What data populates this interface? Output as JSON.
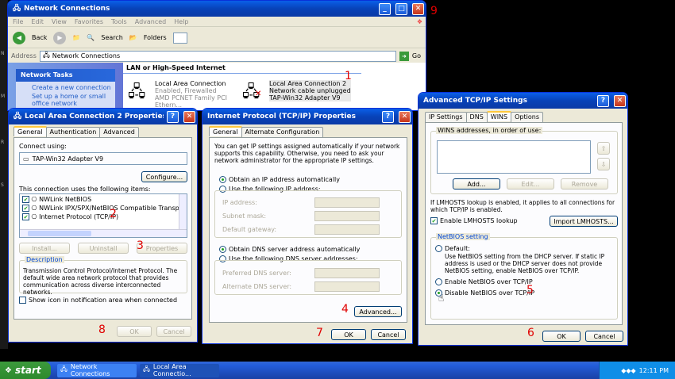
{
  "nc": {
    "title": "Network Connections",
    "menu": [
      "File",
      "Edit",
      "View",
      "Favorites",
      "Tools",
      "Advanced",
      "Help"
    ],
    "back": "Back",
    "search": "Search",
    "folders": "Folders",
    "address_label": "Address",
    "address": "Network Connections",
    "go": "Go",
    "section": "LAN or High-Speed Internet",
    "tasks_title": "Network Tasks",
    "task1": "Create a new connection",
    "task2": "Set up a home or small",
    "task3": "office network",
    "lac1": {
      "name": "Local Area Connection",
      "status": "Enabled, Firewalled",
      "device": "AMD PCNET Family PCI Ethern..."
    },
    "lac2": {
      "name": "Local Area Connection 2",
      "status": "Network cable unplugged",
      "device": "TAP-Win32 Adapter V9"
    }
  },
  "lp": {
    "title": "Local Area Connection 2 Properties",
    "tabs": [
      "General",
      "Authentication",
      "Advanced"
    ],
    "connect_using": "Connect using:",
    "adapter": "TAP-Win32 Adapter V9",
    "configure": "Configure...",
    "items_label": "This connection uses the following items:",
    "items": [
      "NWLink NetBIOS",
      "NWLink IPX/SPX/NetBIOS Compatible Transport Prot",
      "Internet Protocol (TCP/IP)"
    ],
    "install": "Install...",
    "uninstall": "Uninstall",
    "properties": "Properties",
    "desc_label": "Description",
    "desc": "Transmission Control Protocol/Internet Protocol. The default wide area network protocol that provides communication across diverse interconnected networks.",
    "show_icon": "Show icon in notification area when connected",
    "ok": "OK",
    "cancel": "Cancel"
  },
  "ip": {
    "title": "Internet Protocol (TCP/IP) Properties",
    "tabs": [
      "General",
      "Alternate Configuration"
    ],
    "intro": "You can get IP settings assigned automatically if your network supports this capability. Otherwise, you need to ask your network administrator for the appropriate IP settings.",
    "auto_ip": "Obtain an IP address automatically",
    "use_ip": "Use the following IP address:",
    "ip_addr": "IP address:",
    "subnet": "Subnet mask:",
    "gateway": "Default gateway:",
    "auto_dns": "Obtain DNS server address automatically",
    "use_dns": "Use the following DNS server addresses:",
    "pref_dns": "Preferred DNS server:",
    "alt_dns": "Alternate DNS server:",
    "advanced": "Advanced...",
    "ok": "OK",
    "cancel": "Cancel"
  },
  "adv": {
    "title": "Advanced TCP/IP Settings",
    "tabs": [
      "IP Settings",
      "DNS",
      "WINS",
      "Options"
    ],
    "wins_label": "WINS addresses, in order of use:",
    "add": "Add...",
    "edit": "Edit...",
    "remove": "Remove",
    "lmhosts_note": "If LMHOSTS lookup is enabled, it applies to all connections for which TCP/IP is enabled.",
    "enable_lmhosts": "Enable LMHOSTS lookup",
    "import": "Import LMHOSTS...",
    "netbios_label": "NetBIOS setting",
    "default": "Default:",
    "default_desc": "Use NetBIOS setting from the DHCP server. If static IP address is used or the DHCP server does not provide NetBIOS setting, enable NetBIOS over TCP/IP.",
    "enable_nb": "Enable NetBIOS over TCP/IP",
    "disable_nb": "Disable NetBIOS over TCP/IP",
    "ok": "OK",
    "cancel": "Cancel"
  },
  "steps": [
    "1",
    "2",
    "3",
    "4",
    "5",
    "6",
    "7",
    "8",
    "9"
  ],
  "taskbar": {
    "start": "start",
    "item1": "Network Connections",
    "item2": "Local Area Connectio...",
    "time": "12:11 PM"
  },
  "side_labels": [
    "N",
    "M",
    "R",
    "S"
  ]
}
